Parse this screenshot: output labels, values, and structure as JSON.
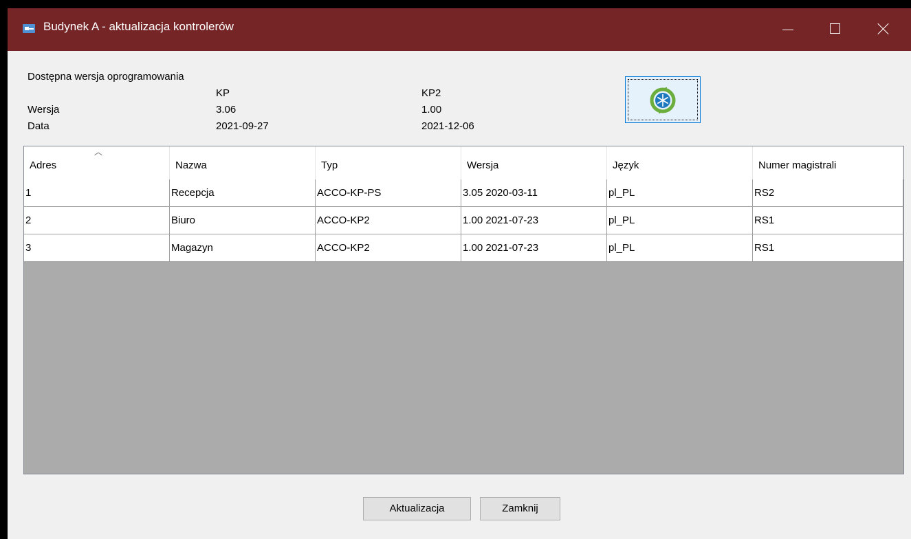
{
  "window": {
    "title": "Budynek A - aktualizacja kontrolerów"
  },
  "icons": {
    "app": "key-icon",
    "firmware": "firmware-update-icon"
  },
  "colors": {
    "titlebar": "#752526",
    "accent": "#0078d7"
  },
  "firmware": {
    "section_label": "Dostępna wersja oprogramowania",
    "row_version_label": "Wersja",
    "row_date_label": "Data",
    "kp": {
      "name": "KP",
      "version": "3.06",
      "date": "2021-09-27"
    },
    "kp2": {
      "name": "KP2",
      "version": "1.00",
      "date": "2021-12-06"
    }
  },
  "table": {
    "columns": [
      "Adres",
      "Nazwa",
      "Typ",
      "Wersja",
      "Język",
      "Numer magistrali"
    ],
    "sort_column": "Adres",
    "rows": [
      [
        "1",
        "Recepcja",
        "ACCO-KP-PS",
        "3.05 2020-03-11",
        "pl_PL",
        "RS2"
      ],
      [
        "2",
        "Biuro",
        "ACCO-KP2",
        "1.00 2021-07-23",
        "pl_PL",
        "RS1"
      ],
      [
        "3",
        "Magazyn",
        "ACCO-KP2",
        "1.00 2021-07-23",
        "pl_PL",
        "RS1"
      ]
    ]
  },
  "buttons": {
    "update": "Aktualizacja",
    "close": "Zamknij"
  }
}
